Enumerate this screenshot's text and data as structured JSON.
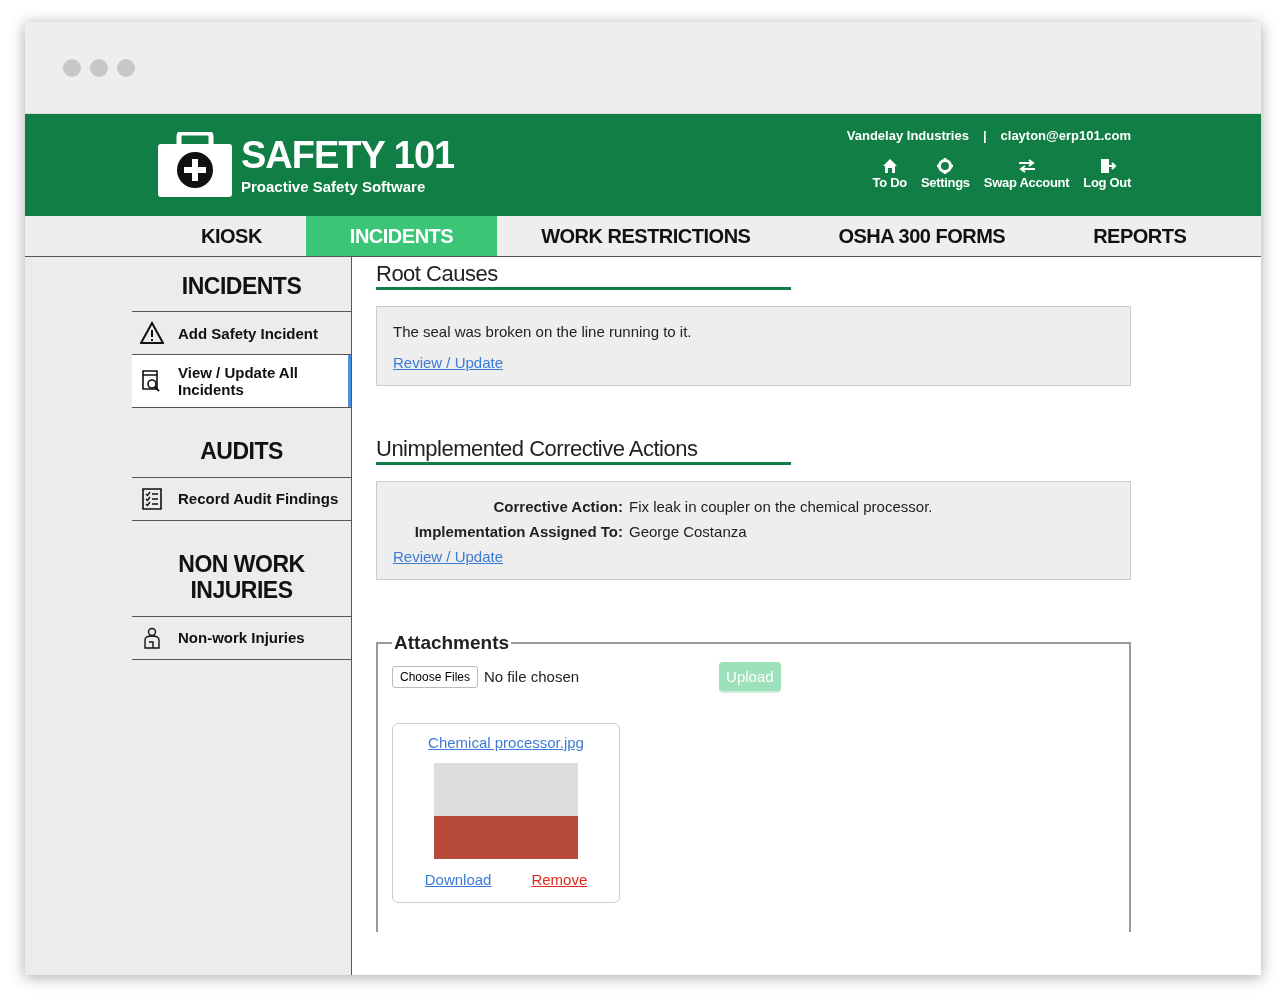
{
  "header": {
    "logo_title": "SAFETY 101",
    "logo_subtitle": "Proactive Safety Software",
    "company": "Vandelay Industries",
    "separator": "|",
    "email": "clayton@erp101.com",
    "actions": [
      {
        "kind": "home",
        "label": "To Do"
      },
      {
        "kind": "gear",
        "label": "Settings"
      },
      {
        "kind": "swap",
        "label": "Swap Account"
      },
      {
        "kind": "exit",
        "label": "Log Out"
      }
    ]
  },
  "tabs": [
    {
      "label": "KIOSK",
      "selected": false
    },
    {
      "label": "INCIDENTS",
      "selected": true
    },
    {
      "label": "WORK RESTRICTIONS",
      "selected": false
    },
    {
      "label": "OSHA 300 FORMS",
      "selected": false
    },
    {
      "label": "REPORTS",
      "selected": false
    }
  ],
  "sidebar": {
    "sections": [
      {
        "title": "INCIDENTS",
        "items": [
          {
            "kind": "warning",
            "label": "Add Safety Incident",
            "selected": false
          },
          {
            "kind": "search-doc",
            "label": "View / Update All Incidents",
            "selected": true
          }
        ]
      },
      {
        "title": "AUDITS",
        "items": [
          {
            "kind": "checklist",
            "label": "Record Audit Findings",
            "selected": false
          }
        ]
      },
      {
        "title": "NON WORK INJURIES",
        "items": [
          {
            "kind": "person",
            "label": "Non-work Injuries",
            "selected": false
          }
        ]
      }
    ]
  },
  "root_causes": {
    "title": "Root Causes",
    "text": "The seal was broken on the line running to it.",
    "link": "Review / Update"
  },
  "corrective_actions": {
    "title": "Unimplemented Corrective Actions",
    "fields": [
      {
        "label": "Corrective Action:",
        "value": "Fix leak in coupler on the chemical processor."
      },
      {
        "label": "Implementation Assigned To:",
        "value": "George Costanza"
      }
    ],
    "link": "Review / Update"
  },
  "attachments": {
    "title": "Attachments",
    "choose_button": "Choose Files",
    "file_status": "No file chosen",
    "upload_button": "Upload",
    "upload_disabled": true,
    "files": [
      {
        "name": "Chemical processor.jpg",
        "download": "Download",
        "remove": "Remove"
      }
    ]
  }
}
